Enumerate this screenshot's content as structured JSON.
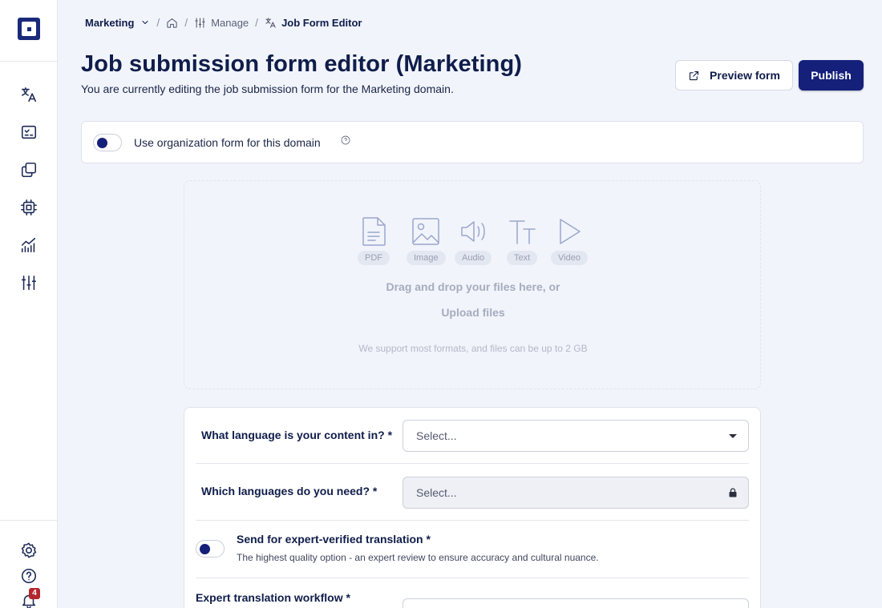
{
  "sidebar": {
    "items": [
      {
        "name": "translate-icon"
      },
      {
        "name": "jobs-icon"
      },
      {
        "name": "files-icon"
      },
      {
        "name": "chip-icon"
      },
      {
        "name": "analytics-icon"
      },
      {
        "name": "manage-sliders-icon"
      }
    ],
    "bottom": [
      {
        "name": "settings-gear-icon"
      },
      {
        "name": "help-icon"
      },
      {
        "name": "bell-icon"
      }
    ],
    "notification_count": "4"
  },
  "breadcrumb": {
    "domain": "Marketing",
    "manage": "Manage",
    "current": "Job Form Editor"
  },
  "header": {
    "title": "Job submission form editor (Marketing)",
    "subtitle": "You are currently editing the job submission form for the Marketing domain.",
    "preview_label": "Preview form",
    "publish_label": "Publish"
  },
  "org_form": {
    "label": "Use organization form for this domain"
  },
  "upload": {
    "file_types": [
      "PDF",
      "Image",
      "Audio",
      "Text",
      "Video"
    ],
    "drag_text": "Drag and drop your files here, or",
    "upload_label": "Upload files",
    "support_text": "We support most formats, and files can be up to 2 GB"
  },
  "fields": {
    "source_language": {
      "label": "What language is your content in? *",
      "placeholder": "Select..."
    },
    "target_languages": {
      "label": "Which languages do you need? *",
      "placeholder": "Select..."
    },
    "expert": {
      "title": "Send for expert-verified translation *",
      "description": "The highest quality option - an expert review to ensure accuracy and cultural nuance."
    },
    "workflow": {
      "label": "Expert translation workflow *"
    }
  },
  "colors": {
    "brand": "#14207a",
    "background": "#f1f4fb",
    "badge": "#b3262e"
  }
}
